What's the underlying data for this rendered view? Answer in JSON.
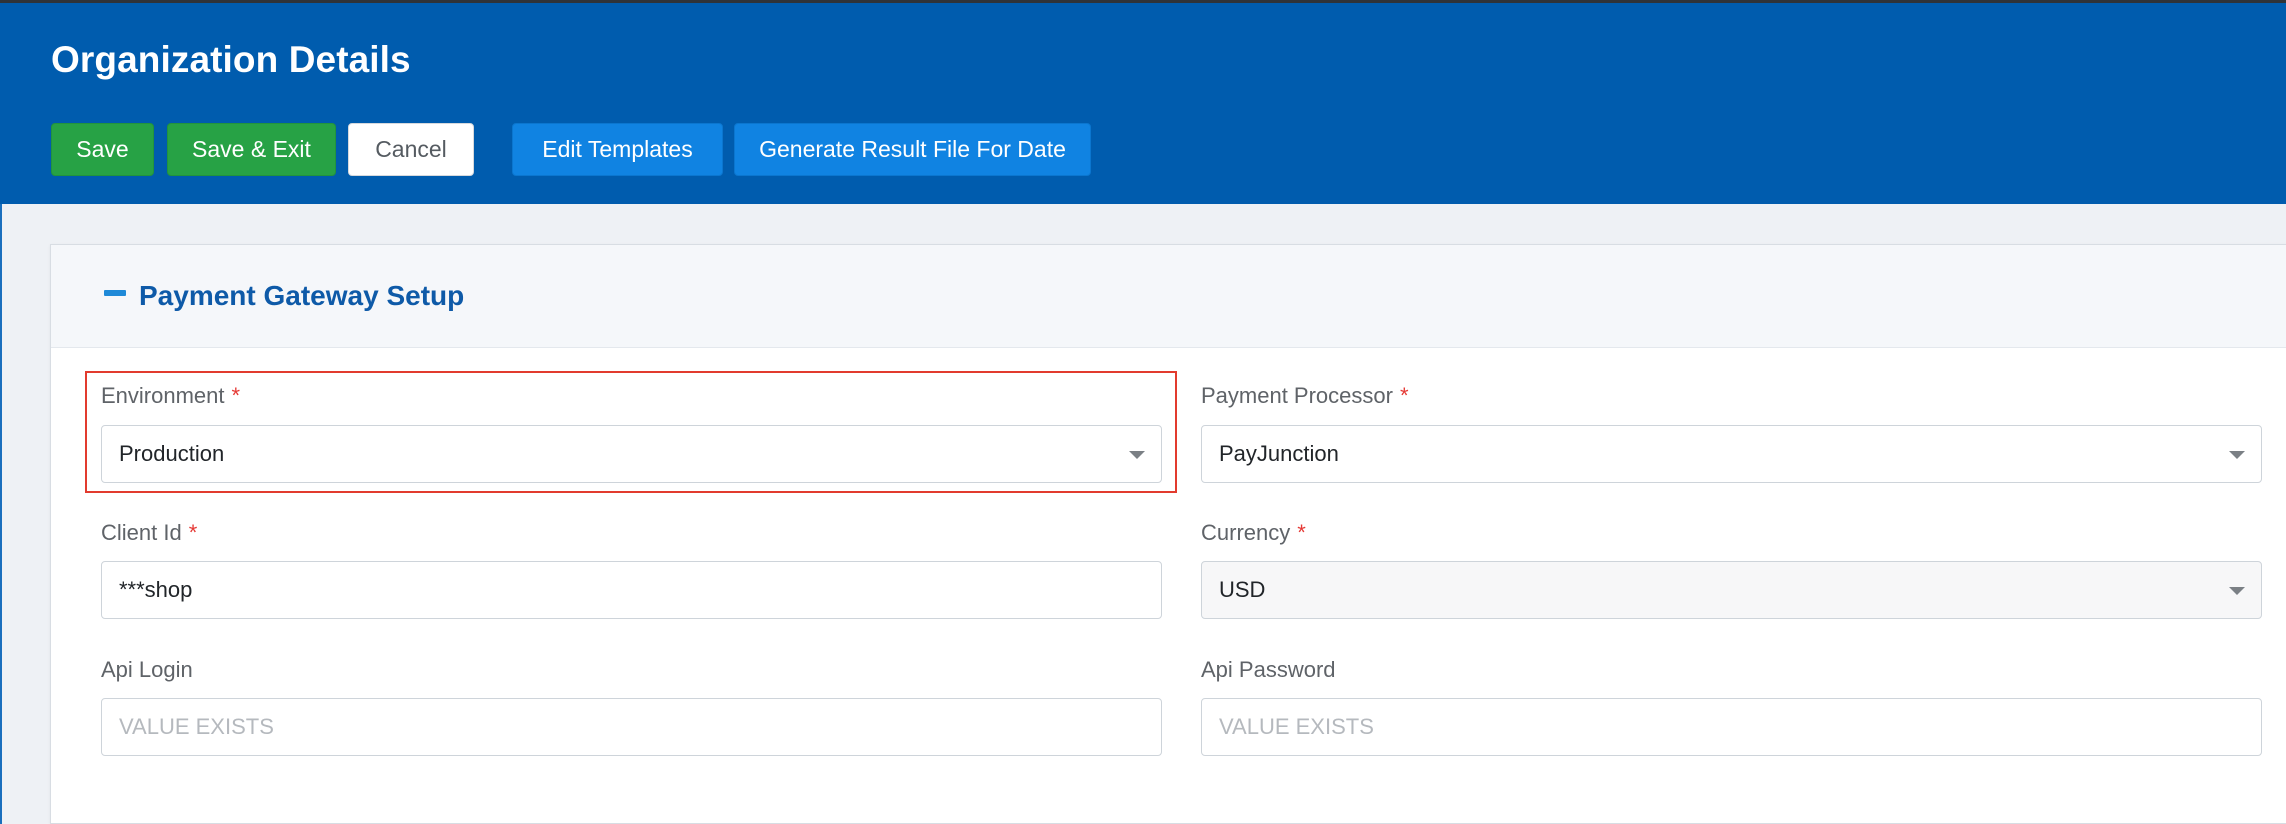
{
  "header": {
    "title": "Organization Details",
    "buttons": {
      "save": "Save",
      "save_exit": "Save & Exit",
      "cancel": "Cancel",
      "edit_templates": "Edit Templates",
      "generate_result": "Generate Result File For Date"
    }
  },
  "panel": {
    "title": "Payment Gateway Setup",
    "collapse_icon": "minus-icon"
  },
  "fields": {
    "environment": {
      "label": "Environment",
      "required": "*",
      "value": "Production"
    },
    "payment_processor": {
      "label": "Payment Processor",
      "required": "*",
      "value": "PayJunction"
    },
    "client_id": {
      "label": "Client Id",
      "required": "*",
      "value": "***shop"
    },
    "currency": {
      "label": "Currency",
      "required": "*",
      "value": "USD"
    },
    "api_login": {
      "label": "Api Login",
      "placeholder": "VALUE EXISTS"
    },
    "api_password": {
      "label": "Api Password",
      "placeholder": "VALUE EXISTS"
    }
  },
  "colors": {
    "header_bg": "#005cae",
    "green_button": "#27a245",
    "blue_button": "#1083e2",
    "required_star": "#e53935",
    "highlight_border": "#e23b2e"
  }
}
